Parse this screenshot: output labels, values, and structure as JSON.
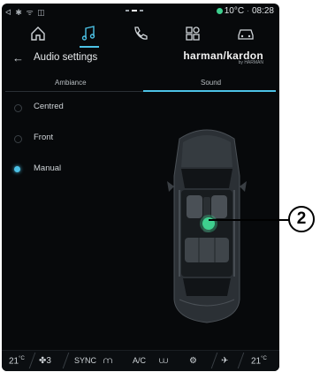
{
  "status_bar": {
    "left_icons": "ᐊ ✱ ᯤ ◫",
    "temperature": "10°C",
    "time": "08:28"
  },
  "top_nav": {
    "items": [
      {
        "icon": "home-icon"
      },
      {
        "icon": "music-note-icon",
        "active": true
      },
      {
        "icon": "phone-icon"
      },
      {
        "icon": "apps-grid-icon"
      },
      {
        "icon": "car-icon"
      }
    ]
  },
  "header": {
    "back_symbol": "←",
    "title": "Audio settings",
    "brand_main": "harman/kardon",
    "brand_sub": "by HARMAN"
  },
  "tabs": [
    {
      "label": "Ambiance",
      "active": false
    },
    {
      "label": "Sound",
      "active": true
    }
  ],
  "options": [
    {
      "label": "Centred",
      "selected": false
    },
    {
      "label": "Front",
      "selected": false
    },
    {
      "label": "Manual",
      "selected": true
    }
  ],
  "bottom_bar": {
    "left_temp": "21",
    "fan_speed": "3",
    "sync": "SYNC",
    "ac": "A/C",
    "right_temp": "21"
  },
  "callout": "2",
  "colors": {
    "accent": "#4cc2e6",
    "focus_point": "#3ecf8e",
    "background": "#07090b"
  }
}
